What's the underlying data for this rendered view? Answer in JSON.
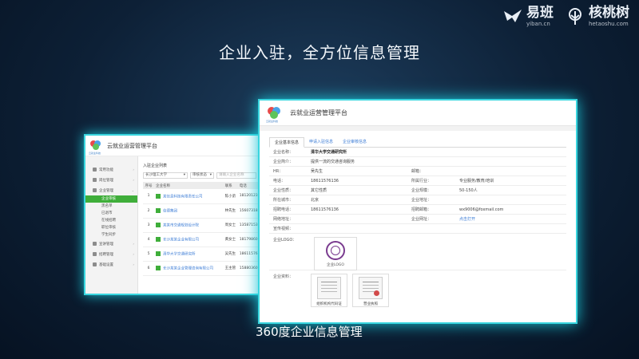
{
  "headline": "企业入驻，全方位信息管理",
  "caption": "360度企业信息管理",
  "logos": [
    {
      "name": "易班",
      "sub": "yiban.cn"
    },
    {
      "name": "核桃树",
      "sub": "hetaoshu.com"
    }
  ],
  "app": {
    "title": "云就业运营管理平台",
    "brand_small": "云就业科技"
  },
  "windowA": {
    "sidebar": {
      "groups": [
        {
          "label": "常用功能"
        },
        {
          "label": "岗位管理"
        },
        {
          "label": "企业管理",
          "subs": [
            "企业审核",
            "黑名单",
            "已退市",
            "在线招聘",
            "职位审核",
            "学生同步"
          ]
        },
        {
          "label": "宣讲管理"
        },
        {
          "label": "招聘管理"
        },
        {
          "label": "基础设置"
        }
      ]
    },
    "page_title": "入驻企业列表",
    "filters": {
      "school": "长沙理工大学",
      "status": "审核状态",
      "search_placeholder": "请输入企业名称"
    },
    "table": {
      "headers": [
        "序号",
        "企业名称",
        "联系",
        "电话"
      ],
      "rows": [
        {
          "idx": "1",
          "company": "某信息科技有限责任公司",
          "contact": "陈小弟",
          "phone": "18120123769"
        },
        {
          "idx": "2",
          "company": "佳德集团",
          "contact": "林先生",
          "phone": "15607318601"
        },
        {
          "idx": "3",
          "company": "某某市交通规划设计院",
          "contact": "周女士",
          "phone": "13587153988"
        },
        {
          "idx": "4",
          "company": "长沙某某企业有限公司",
          "contact": "黄女士",
          "phone": "18179860123"
        },
        {
          "idx": "5",
          "company": "清华大学交通研究所",
          "contact": "吴先生",
          "phone": "18611576136"
        },
        {
          "idx": "6",
          "company": "长沙某某企业管理咨询有限公司",
          "contact": "王主管",
          "phone": "15880360000"
        }
      ]
    }
  },
  "windowB": {
    "tabs": [
      "企业基本信息",
      "申请入驻信息",
      "企业审核信息"
    ],
    "fields": {
      "name": {
        "label": "企业名称：",
        "value": "清华大学交通研究所"
      },
      "intro": {
        "label": "企业简介：",
        "value": "提供一流的交通咨询服务"
      },
      "hr": {
        "label": "HR：",
        "value": "吴先生"
      },
      "email": {
        "label": "邮箱：",
        "value": ""
      },
      "phone": {
        "label": "电话：",
        "value": "18611576136"
      },
      "industry": {
        "label": "所属行业：",
        "value": "专业服务/教育/培训"
      },
      "nature": {
        "label": "企业性质：",
        "value": "其它性质"
      },
      "scale": {
        "label": "企业规模：",
        "value": "50-150人"
      },
      "city": {
        "label": "所在城市：",
        "value": "北京"
      },
      "address": {
        "label": "企业地址：",
        "value": ""
      },
      "recruit_phone": {
        "label": "招聘电话：",
        "value": "18611576136"
      },
      "recruit_email": {
        "label": "招聘邮箱：",
        "value": "wx9006@foxmail.com"
      },
      "site": {
        "label": "网络地址：",
        "value": ""
      },
      "company_site": {
        "label": "企业网址：",
        "value": "点击打开"
      },
      "video": {
        "label": "宣传视频：",
        "value": ""
      },
      "logo": {
        "label": "企业LOGO：",
        "caption": "企业LOGO"
      },
      "files": {
        "label": "企业资料：",
        "items": [
          "组织机构代码证",
          "营业执照"
        ]
      }
    }
  }
}
